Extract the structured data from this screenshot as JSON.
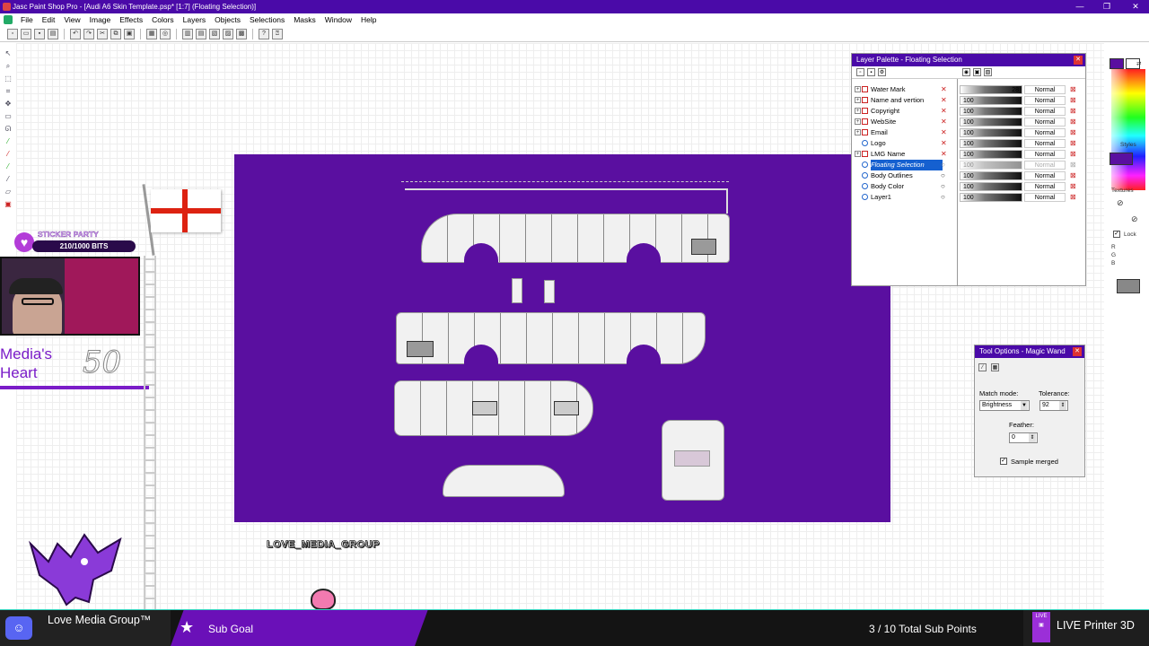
{
  "window": {
    "title": "Jasc Paint Shop Pro - [Audi A6 Skin Template.psp* [1:7] (Floating Selection)]",
    "controls": [
      "—",
      "❐",
      "✕"
    ]
  },
  "menubar": [
    "File",
    "Edit",
    "View",
    "Image",
    "Effects",
    "Colors",
    "Layers",
    "Objects",
    "Selections",
    "Masks",
    "Window",
    "Help"
  ],
  "toolbar": {
    "buttons": [
      "new-icon",
      "open-icon",
      "save-icon",
      "print-icon",
      "undo-icon",
      "redo-icon",
      "cut-icon",
      "copy-icon",
      "paste-icon",
      "browse-icon",
      "palette-icon",
      "overview-icon",
      "toolbar-icon",
      "layer-icon",
      "histogram-icon",
      "help-icon",
      "context-help-icon"
    ]
  },
  "toolbox": [
    "arrow-tool-icon",
    "zoom-tool-icon",
    "selection-tool-icon",
    "crop-tool-icon",
    "mover-tool-icon",
    "rect-select-icon",
    "lasso-icon",
    "magic-wand-icon",
    "dropper-icon",
    "brush-icon",
    "clone-icon",
    "eraser-icon",
    "fill-icon"
  ],
  "canvas": {
    "watermark": "LOVE_MEDIA_GROUP",
    "background_color": "#5a0fa0"
  },
  "stream_overlay": {
    "sticker_title": "STICKER PARTY",
    "sticker_bits": "210/1000 BITS",
    "media_heart": "Media's Heart",
    "media_heart_count": "50",
    "footer": {
      "discord_name": "Love Media Group™",
      "goal_label": "Sub Goal",
      "points": "3 / 10 Total Sub Points",
      "live_name": "LIVE Printer 3D"
    }
  },
  "layer_palette": {
    "title": "Layer Palette - Floating Selection",
    "layers": [
      {
        "name": "Water Mark",
        "opacity": "28",
        "blend": "Normal",
        "selected": false
      },
      {
        "name": "Name and vertion",
        "opacity": "100",
        "blend": "Normal",
        "selected": false
      },
      {
        "name": "Copyright",
        "opacity": "100",
        "blend": "Normal",
        "selected": false
      },
      {
        "name": "WebSite",
        "opacity": "100",
        "blend": "Normal",
        "selected": false
      },
      {
        "name": "Email",
        "opacity": "100",
        "blend": "Normal",
        "selected": false
      },
      {
        "name": "Logo",
        "opacity": "100",
        "blend": "Normal",
        "selected": false
      },
      {
        "name": "LMG Name",
        "opacity": "100",
        "blend": "Normal",
        "selected": false
      },
      {
        "name": "Floating Selection",
        "opacity": "100",
        "blend": "Normal",
        "selected": true
      },
      {
        "name": "Body Outlines",
        "opacity": "100",
        "blend": "Normal",
        "selected": false
      },
      {
        "name": "Body Color",
        "opacity": "100",
        "blend": "Normal",
        "selected": false
      },
      {
        "name": "Layer1",
        "opacity": "100",
        "blend": "Normal",
        "selected": false
      }
    ]
  },
  "tool_options": {
    "title": "Tool Options - Magic Wand",
    "match_mode_label": "Match mode:",
    "match_mode_value": "Brightness",
    "tolerance_label": "Tolerance:",
    "tolerance_value": "92",
    "feather_label": "Feather:",
    "feather_value": "0",
    "sample_merged_label": "Sample merged",
    "sample_merged_checked": true
  },
  "materials": {
    "styles_label": "Styles",
    "textures_label": "Textures",
    "lock_label": "Lock",
    "rgb_labels": [
      "R",
      "G",
      "B"
    ],
    "foreground_color": "#5a0fa0",
    "background_color": "#ffffff"
  }
}
